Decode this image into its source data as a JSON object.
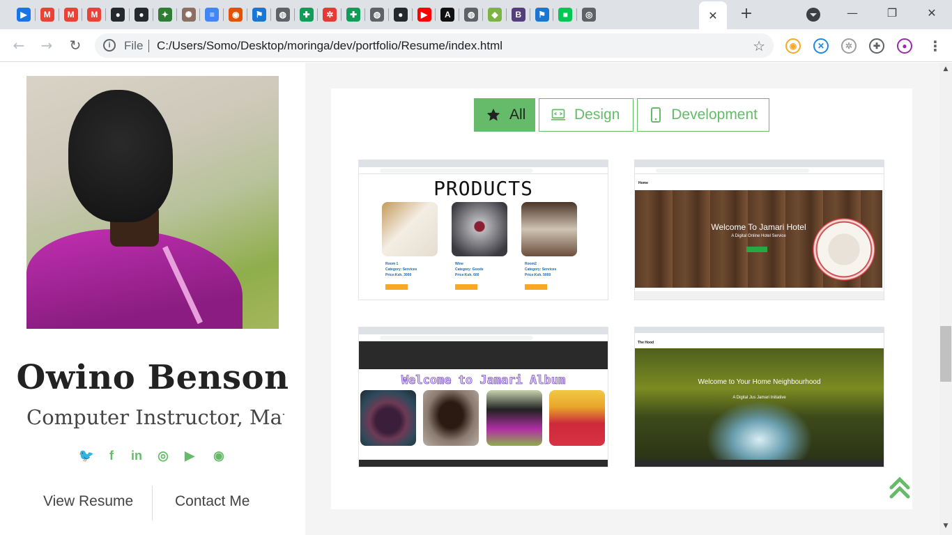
{
  "browser": {
    "tabs": [
      {
        "icon": "play-icon",
        "color": "#1a73e8",
        "glyph": "▶"
      },
      {
        "icon": "gmail-icon",
        "color": "#ea4335",
        "glyph": "M"
      },
      {
        "icon": "gmail-icon",
        "color": "#ea4335",
        "glyph": "M"
      },
      {
        "icon": "gmail-icon",
        "color": "#ea4335",
        "glyph": "M"
      },
      {
        "icon": "github-icon",
        "color": "#24292e",
        "glyph": "●"
      },
      {
        "icon": "github-icon",
        "color": "#24292e",
        "glyph": "●"
      },
      {
        "icon": "kenya-icon",
        "color": "#2e7d32",
        "glyph": "✦"
      },
      {
        "icon": "coat-of-arms-icon",
        "color": "#8d6e63",
        "glyph": "✺"
      },
      {
        "icon": "docs-icon",
        "color": "#4285f4",
        "glyph": "≡"
      },
      {
        "icon": "maps-icon",
        "color": "#e65100",
        "glyph": "◉"
      },
      {
        "icon": "flag-icon",
        "color": "#1976d2",
        "glyph": "⚑"
      },
      {
        "icon": "globe-icon",
        "color": "#5f6368",
        "glyph": "◍"
      },
      {
        "icon": "plus-square-icon",
        "color": "#0f9d58",
        "glyph": "✚"
      },
      {
        "icon": "wheel-icon",
        "color": "#e53935",
        "glyph": "✲"
      },
      {
        "icon": "plus-square-icon",
        "color": "#0f9d58",
        "glyph": "✚"
      },
      {
        "icon": "globe-icon",
        "color": "#5f6368",
        "glyph": "◍"
      },
      {
        "icon": "github-icon",
        "color": "#24292e",
        "glyph": "●"
      },
      {
        "icon": "youtube-icon",
        "color": "#ff0000",
        "glyph": "▶"
      },
      {
        "icon": "angular-icon",
        "color": "#111111",
        "glyph": "A"
      },
      {
        "icon": "globe-icon",
        "color": "#5f6368",
        "glyph": "◍"
      },
      {
        "icon": "android-icon",
        "color": "#7cb342",
        "glyph": "◆"
      },
      {
        "icon": "bootstrap-icon",
        "color": "#563d7c",
        "glyph": "B"
      },
      {
        "icon": "flag-icon",
        "color": "#1976d2",
        "glyph": "⚑"
      },
      {
        "icon": "green-square-icon",
        "color": "#00c853",
        "glyph": "■"
      },
      {
        "icon": "chrome-icon",
        "color": "#5f6368",
        "glyph": "◎"
      }
    ],
    "active_tab_close": "✕",
    "new_tab": "+",
    "url_scheme": "File",
    "url": "C:/Users/Somo/Desktop/moringa/dev/portfolio/Resume/index.html",
    "extensions": [
      {
        "icon": "honey-icon",
        "color": "#f9a825",
        "glyph": "◉"
      },
      {
        "icon": "translate-icon",
        "color": "#1e88e5",
        "glyph": "✕"
      },
      {
        "icon": "gear-extension-icon",
        "color": "#9e9e9e",
        "glyph": "✲"
      },
      {
        "icon": "puzzle-icon",
        "color": "#5f6368",
        "glyph": "✚"
      },
      {
        "icon": "profile-avatar-icon",
        "color": "#9c27b0",
        "glyph": "●"
      }
    ]
  },
  "profile": {
    "name": "Owino Benson",
    "role": "Computer Instructor, Mat|",
    "social": [
      {
        "icon": "twitter-icon",
        "glyph": "🐦"
      },
      {
        "icon": "facebook-icon",
        "glyph": "f"
      },
      {
        "icon": "linkedin-icon",
        "glyph": "in"
      },
      {
        "icon": "instagram-icon",
        "glyph": "◎"
      },
      {
        "icon": "youtube-icon",
        "glyph": "▶"
      },
      {
        "icon": "github-icon",
        "glyph": "◉"
      }
    ],
    "view_resume": "View Resume",
    "contact_me": "Contact Me"
  },
  "portfolio": {
    "filters": [
      {
        "label": "All",
        "icon": "star-icon",
        "active": true
      },
      {
        "label": "Design",
        "icon": "laptop-code-icon",
        "active": false
      },
      {
        "label": "Development",
        "icon": "mobile-icon",
        "active": false
      }
    ],
    "shots": [
      {
        "name": "products-screenshot",
        "title": "PRODUCTS",
        "items": [
          {
            "name": "Room 1",
            "category": "Category: Services",
            "price": "Price:Ksh. 3000",
            "button": "ADD TO CART"
          },
          {
            "name": "Wine",
            "category": "Category: Goods",
            "price": "Price:Ksh. 600",
            "button": "ADD TO CART"
          },
          {
            "name": "Room2",
            "category": "Category: Services",
            "price": "Price:Ksh. 5000",
            "button": "ADD TO CART"
          }
        ]
      },
      {
        "name": "hotel-screenshot",
        "nav": "Home",
        "search": "Search products",
        "title": "Welcome To Jamari Hotel",
        "subtitle": "A Digital Online Hotel Service",
        "button": "PRODUCTS"
      },
      {
        "name": "album-screenshot",
        "title": "Welcome to Jamari Album"
      },
      {
        "name": "neighbourhood-screenshot",
        "brand": "The Hood",
        "title": "Welcome to Your Home Neighbourhood",
        "subtitle": "A Digital Jus Jamari Initiative"
      }
    ]
  },
  "colors": {
    "accent": "#66bb6a",
    "jacket": "#c12fb1"
  }
}
